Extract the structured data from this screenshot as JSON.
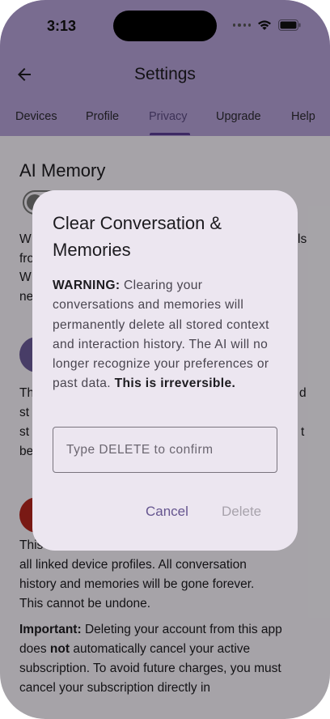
{
  "status_bar": {
    "time": "3:13"
  },
  "app_bar": {
    "title": "Settings"
  },
  "tabs": [
    {
      "label": "Devices",
      "active": false
    },
    {
      "label": "Profile",
      "active": false
    },
    {
      "label": "Privacy",
      "active": true
    },
    {
      "label": "Upgrade",
      "active": false
    },
    {
      "label": "Help",
      "active": false
    }
  ],
  "page": {
    "section_title": "AI Memory",
    "bg_fragments": [
      "W",
      "ls",
      "fro",
      "W",
      "ne",
      "Th",
      "d",
      "st",
      "st",
      "t",
      "be"
    ],
    "delete_account": {
      "line1": "This ... and",
      "line2": "all linked device profiles. All conversation",
      "line3": "history and memories will be gone forever.",
      "line4": "This cannot be undone.",
      "important_label": "Important:",
      "important_text_1": " Deleting your account from this app does ",
      "important_not": "not",
      "important_text_2": " automatically cancel your active subscription. To avoid future charges, you must cancel your subscription directly in"
    }
  },
  "dialog": {
    "title": "Clear Conversation & Memories",
    "warning_label": "WARNING:",
    "body": " Clearing your conversations and memories will permanently delete all stored context and interaction history. The AI will no longer recognize your preferences or past data. ",
    "irreversible": "This is irreversible.",
    "input_placeholder": "Type DELETE to confirm",
    "input_value": "",
    "cancel_label": "Cancel",
    "delete_label": "Delete",
    "delete_enabled": false
  },
  "colors": {
    "header": "#b39fd4",
    "accent": "#65558f",
    "dialog_bg": "#ece6f0",
    "danger": "#b3261e"
  },
  "icons": {
    "back": "arrow-left-icon",
    "wifi": "wifi-icon",
    "battery": "battery-icon",
    "signal": "signal-dots-icon"
  }
}
